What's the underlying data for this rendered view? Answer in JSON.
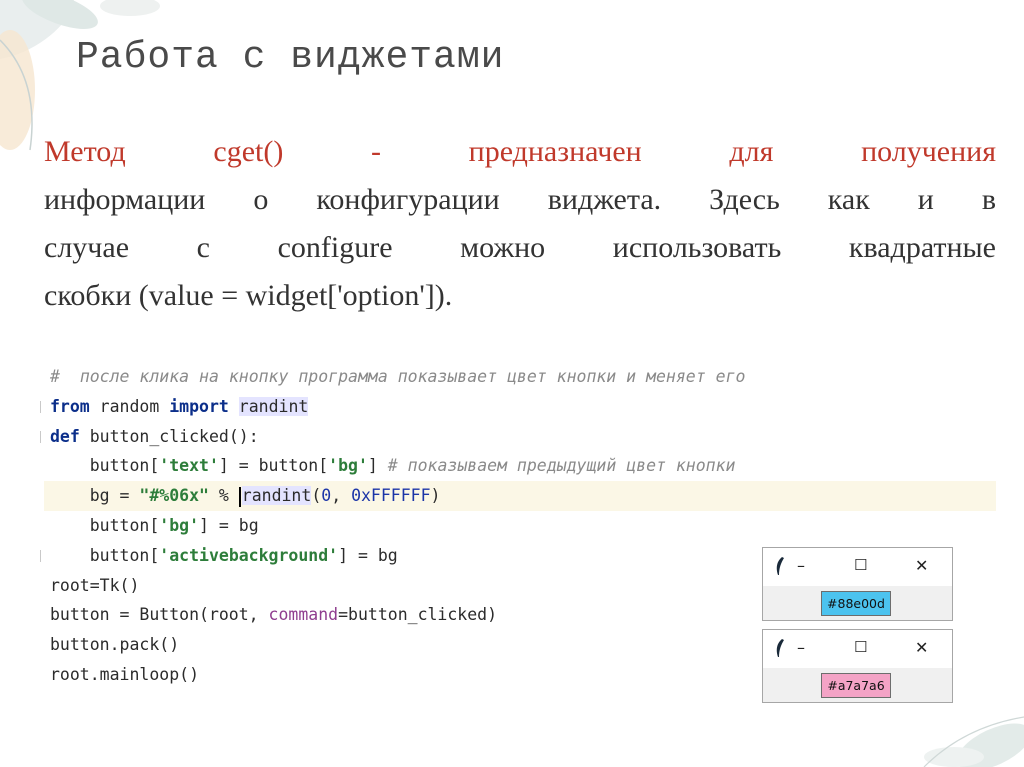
{
  "slide": {
    "title": "Работа с виджетами",
    "paragraph": {
      "line1_a": "Метод",
      "line1_b": "cget()",
      "line1_c": "-",
      "line1_d": "предназначен",
      "line1_e": "для",
      "line1_f": "получения",
      "line2": "информации о конфигурации виджета. Здесь как и в",
      "line3": "случае с configure можно использовать квадратные",
      "line4": "скобки (value = widget['option'])."
    }
  },
  "code": {
    "comment1_hash": "#",
    "comment1_text": "после клика на кнопку программа показывает цвет кнопки и меняет его",
    "kw_from": "from",
    "mod_random": " random ",
    "kw_import": "import",
    "fn_randint": "randint",
    "kw_def": "def",
    "def_rest": " button_clicked():",
    "l4_a": "    button[",
    "l4_s1": "'text'",
    "l4_b": "] = button[",
    "l4_s2": "'bg'",
    "l4_c": "] ",
    "l4_comment": "# показываем предыдущий цвет кнопки",
    "l5_a": "    bg = ",
    "l5_s": "\"#%06x\"",
    "l5_b": " % ",
    "l5_fn": "randint",
    "l5_c": "(",
    "l5_n1": "0",
    "l5_d": ", ",
    "l5_n2": "0xFFFFFF",
    "l5_e": ")",
    "l6_a": "    button[",
    "l6_s": "'bg'",
    "l6_b": "] = bg",
    "l7_a": "    button[",
    "l7_s": "'activebackground'",
    "l7_b": "] = bg",
    "l8": "root=Tk()",
    "l9_a": "button = Button(root, ",
    "l9_param": "command",
    "l9_b": "=button_clicked)",
    "l10": "button.pack()",
    "l11": "root.mainloop()"
  },
  "windows": [
    {
      "icon": "feather-icon",
      "minimize": "–",
      "maximize": "☐",
      "close": "✕",
      "button_label": "#88e00d",
      "button_color": "#4cc3ef"
    },
    {
      "icon": "feather-icon",
      "minimize": "–",
      "maximize": "☐",
      "close": "✕",
      "button_label": "#a7a7a6",
      "button_color": "#f4a3c6"
    }
  ]
}
